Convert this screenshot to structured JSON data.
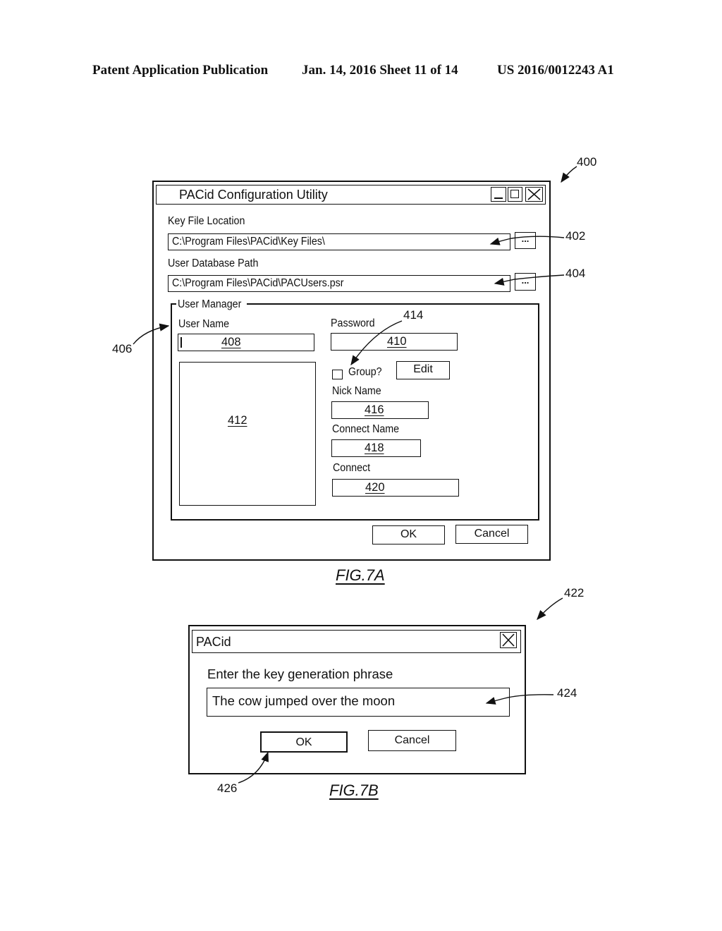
{
  "header": {
    "left": "Patent Application Publication",
    "date_sheet": "Jan. 14, 2016  Sheet 11 of 14",
    "number": "US 2016/0012243 A1"
  },
  "fig7a": {
    "ref_main": "400",
    "window_title": "PACid Configuration Utility",
    "title_buttons": {
      "minimize": "minimize-icon",
      "maximize": "maximize-icon",
      "close": "close-icon"
    },
    "key_file": {
      "label": "Key File Location",
      "value": "C:\\Program Files\\PACid\\Key Files\\",
      "browse_label": "...",
      "ref": "402"
    },
    "user_db": {
      "label": "User Database Path",
      "value": "C:\\Program Files\\PACid\\PACUsers.psr",
      "browse_label": "...",
      "ref": "404"
    },
    "user_manager": {
      "legend": "User Manager",
      "ref": "406",
      "user_name": {
        "label": "User Name",
        "ref": "408"
      },
      "user_list": {
        "ref": "412"
      },
      "password": {
        "label": "Password",
        "ref": "410"
      },
      "group": {
        "label": "Group?",
        "checked": false,
        "ref": "414"
      },
      "edit_label": "Edit",
      "nick_name": {
        "label": "Nick Name",
        "ref": "416"
      },
      "connect_name": {
        "label": "Connect Name",
        "ref": "418"
      },
      "connect": {
        "label": "Connect",
        "ref": "420"
      }
    },
    "ok_label": "OK",
    "cancel_label": "Cancel",
    "caption": "FIG.7A"
  },
  "fig7b": {
    "ref_main": "422",
    "window_title": "PACid",
    "close_icon": "close-icon",
    "prompt": "Enter the key generation phrase",
    "phrase_value": "The cow jumped over the moon",
    "phrase_ref": "424",
    "ok_label": "OK",
    "ok_ref": "426",
    "cancel_label": "Cancel",
    "caption": "FIG.7B"
  }
}
